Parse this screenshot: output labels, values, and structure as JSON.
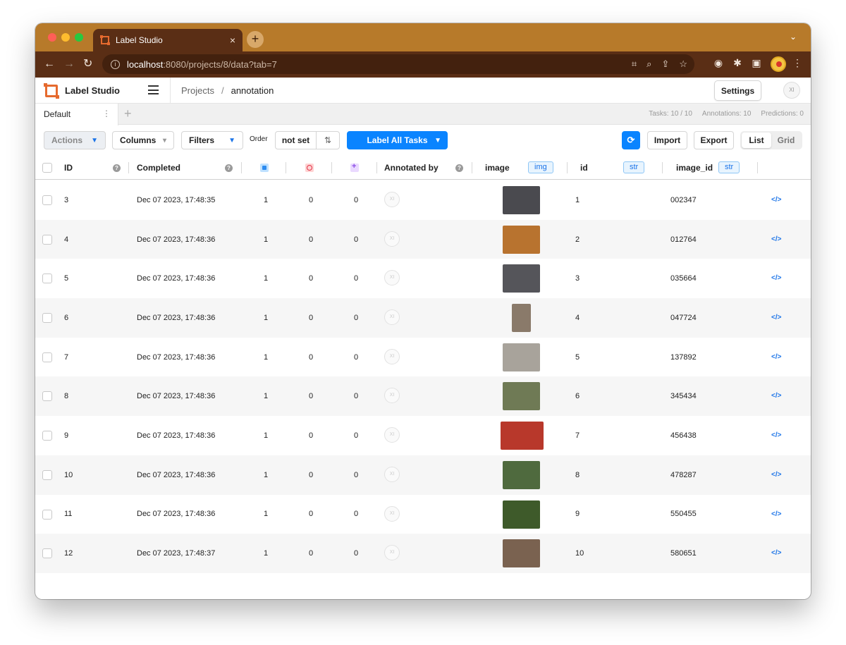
{
  "browser": {
    "tab_title": "Label Studio",
    "tab_close": "×",
    "new_tab": "+",
    "url_host": "localhost",
    "url_rest": ":8080/projects/8/data?tab=7"
  },
  "header": {
    "app_name": "Label Studio",
    "breadcrumb_projects": "Projects",
    "breadcrumb_sep": "/",
    "breadcrumb_current": "annotation",
    "settings_label": "Settings",
    "user_initials": "XI"
  },
  "view_tabs": {
    "active_tab": "Default",
    "tasks_stat": "Tasks: 10 / 10",
    "annotations_stat": "Annotations: 10",
    "predictions_stat": "Predictions: 0"
  },
  "toolbar": {
    "actions_label": "Actions",
    "columns_label": "Columns",
    "filters_label": "Filters",
    "order_label": "Order",
    "order_value": "not set",
    "label_all_label": "Label All Tasks",
    "import_label": "Import",
    "export_label": "Export",
    "view_list": "List",
    "view_grid": "Grid"
  },
  "columns": {
    "id": "ID",
    "completed": "Completed",
    "annotated_by": "Annotated by",
    "image": "image",
    "image_type": "img",
    "data_id": "id",
    "data_id_type": "str",
    "image_id": "image_id",
    "image_id_type": "str"
  },
  "rows": [
    {
      "id": "3",
      "completed": "Dec 07 2023, 17:48:35",
      "total": "1",
      "cancelled": "0",
      "predictions": "0",
      "annotator": "XI",
      "data_id": "1",
      "image_id": "002347",
      "thumb_color": "#4a4a4f"
    },
    {
      "id": "4",
      "completed": "Dec 07 2023, 17:48:36",
      "total": "1",
      "cancelled": "0",
      "predictions": "0",
      "annotator": "XI",
      "data_id": "2",
      "image_id": "012764",
      "thumb_color": "#b8732f"
    },
    {
      "id": "5",
      "completed": "Dec 07 2023, 17:48:36",
      "total": "1",
      "cancelled": "0",
      "predictions": "0",
      "annotator": "XI",
      "data_id": "3",
      "image_id": "035664",
      "thumb_color": "#55555a"
    },
    {
      "id": "6",
      "completed": "Dec 07 2023, 17:48:36",
      "total": "1",
      "cancelled": "0",
      "predictions": "0",
      "annotator": "XI",
      "data_id": "4",
      "image_id": "047724",
      "thumb_color": "#8a7a6a"
    },
    {
      "id": "7",
      "completed": "Dec 07 2023, 17:48:36",
      "total": "1",
      "cancelled": "0",
      "predictions": "0",
      "annotator": "XI",
      "data_id": "5",
      "image_id": "137892",
      "thumb_color": "#a8a39b"
    },
    {
      "id": "8",
      "completed": "Dec 07 2023, 17:48:36",
      "total": "1",
      "cancelled": "0",
      "predictions": "0",
      "annotator": "XI",
      "data_id": "6",
      "image_id": "345434",
      "thumb_color": "#6f7a55"
    },
    {
      "id": "9",
      "completed": "Dec 07 2023, 17:48:36",
      "total": "1",
      "cancelled": "0",
      "predictions": "0",
      "annotator": "XI",
      "data_id": "7",
      "image_id": "456438",
      "thumb_color": "#b8382b"
    },
    {
      "id": "10",
      "completed": "Dec 07 2023, 17:48:36",
      "total": "1",
      "cancelled": "0",
      "predictions": "0",
      "annotator": "XI",
      "data_id": "8",
      "image_id": "478287",
      "thumb_color": "#4f6a3e"
    },
    {
      "id": "11",
      "completed": "Dec 07 2023, 17:48:36",
      "total": "1",
      "cancelled": "0",
      "predictions": "0",
      "annotator": "XI",
      "data_id": "9",
      "image_id": "550455",
      "thumb_color": "#3e5a2a"
    },
    {
      "id": "12",
      "completed": "Dec 07 2023, 17:48:37",
      "total": "1",
      "cancelled": "0",
      "predictions": "0",
      "annotator": "XI",
      "data_id": "10",
      "image_id": "580651",
      "thumb_color": "#7a6250"
    }
  ],
  "colors": {
    "tab_strip": "#b77a2a",
    "toolbar": "#5a2e15",
    "accent_blue": "#0a84ff",
    "brand_orange": "#e66a2e"
  }
}
